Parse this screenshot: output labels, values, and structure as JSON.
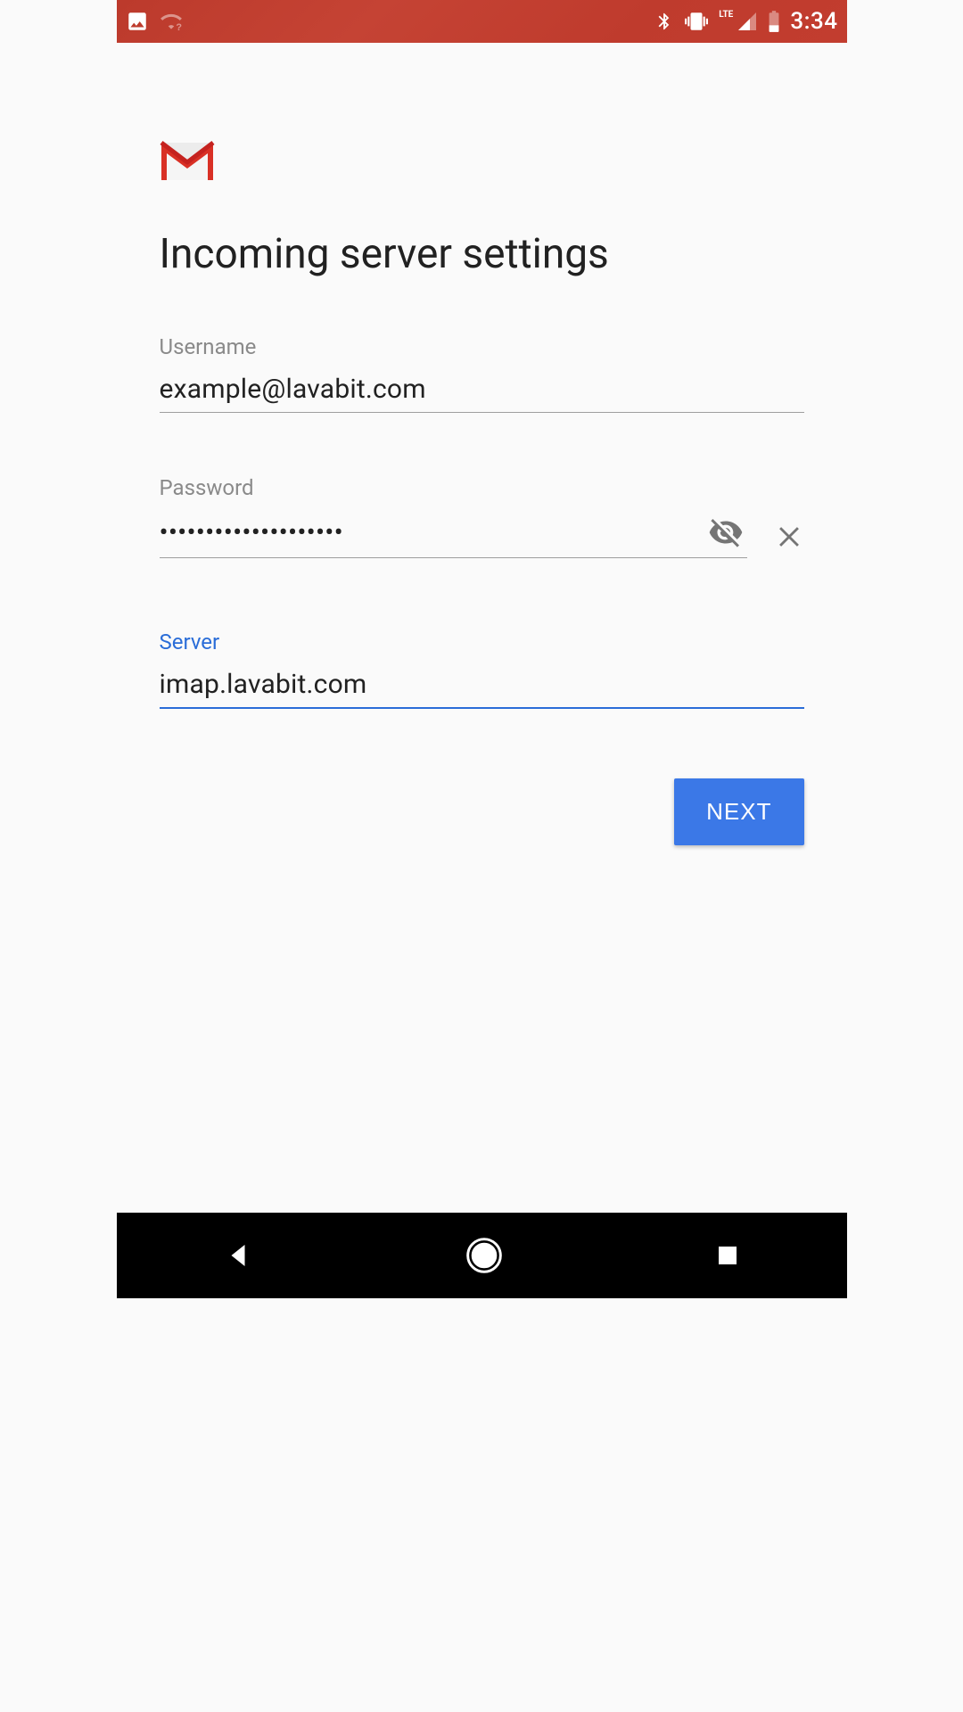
{
  "status_bar": {
    "time": "3:34",
    "network_label": "LTE"
  },
  "page": {
    "title": "Incoming server settings"
  },
  "fields": {
    "username": {
      "label": "Username",
      "value": "example@lavabit.com"
    },
    "password": {
      "label": "Password",
      "value": "••••••••••••••••••••"
    },
    "server": {
      "label": "Server",
      "value": "imap.lavabit.com"
    }
  },
  "buttons": {
    "next": "NEXT"
  }
}
